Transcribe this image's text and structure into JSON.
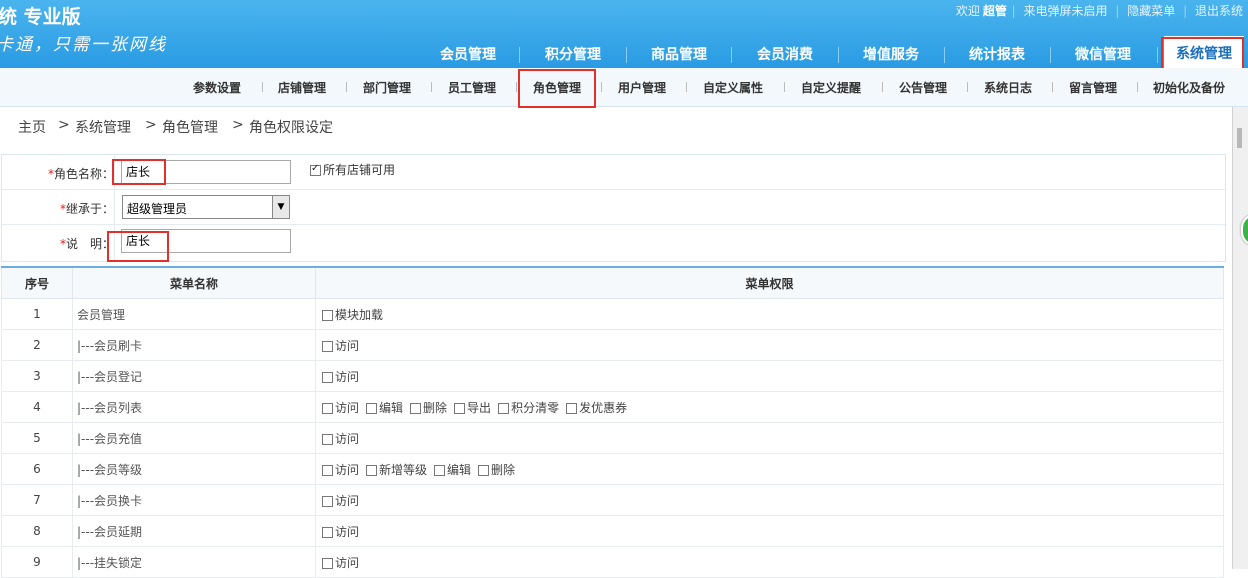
{
  "header": {
    "brand_title": "统 专业版",
    "brand_slogan": "卡通，只需一张网线",
    "welcome": "欢迎",
    "username": "超管",
    "caller_popup": "来电弹屏未启用",
    "hide_menu": "隐藏菜单",
    "logout": "退出系统"
  },
  "main_nav": [
    "会员管理",
    "积分管理",
    "商品管理",
    "会员消费",
    "增值服务",
    "统计报表",
    "微信管理",
    "系统管理"
  ],
  "sub_nav": [
    "参数设置",
    "店铺管理",
    "部门管理",
    "员工管理",
    "角色管理",
    "用户管理",
    "自定义属性",
    "自定义提醒",
    "公告管理",
    "系统日志",
    "留言管理",
    "初始化及备份"
  ],
  "breadcrumb": [
    "主页",
    ">",
    "系统管理",
    ">",
    "角色管理",
    ">",
    "角色权限设定"
  ],
  "form": {
    "required_mark": "*",
    "role_name_label": "角色名称：",
    "role_name_value": "店长",
    "all_stores_label": "所有店铺可用",
    "all_stores_checked": true,
    "inherit_label": "继承于：",
    "inherit_value": "超级管理员",
    "desc_label": "说　明：",
    "desc_value": "店长"
  },
  "table": {
    "headers": [
      "序号",
      "菜单名称",
      "菜单权限"
    ],
    "rows": [
      {
        "idx": "1",
        "menu": "会员管理",
        "perms": [
          "模块加载"
        ]
      },
      {
        "idx": "2",
        "menu": "|---会员刷卡",
        "perms": [
          "访问"
        ]
      },
      {
        "idx": "3",
        "menu": "|---会员登记",
        "perms": [
          "访问"
        ]
      },
      {
        "idx": "4",
        "menu": "|---会员列表",
        "perms": [
          "访问",
          "编辑",
          "删除",
          "导出",
          "积分清零",
          "发优惠券"
        ]
      },
      {
        "idx": "5",
        "menu": "|---会员充值",
        "perms": [
          "访问"
        ]
      },
      {
        "idx": "6",
        "menu": "|---会员等级",
        "perms": [
          "访问",
          "新增等级",
          "编辑",
          "删除"
        ]
      },
      {
        "idx": "7",
        "menu": "|---会员换卡",
        "perms": [
          "访问"
        ]
      },
      {
        "idx": "8",
        "menu": "|---会员延期",
        "perms": [
          "访问"
        ]
      },
      {
        "idx": "9",
        "menu": "|---挂失锁定",
        "perms": [
          "访问"
        ]
      }
    ]
  },
  "colors": {
    "header_blue": "#2a9be3",
    "highlight_red": "#e0312c",
    "table_top_border": "#6aaee0"
  }
}
